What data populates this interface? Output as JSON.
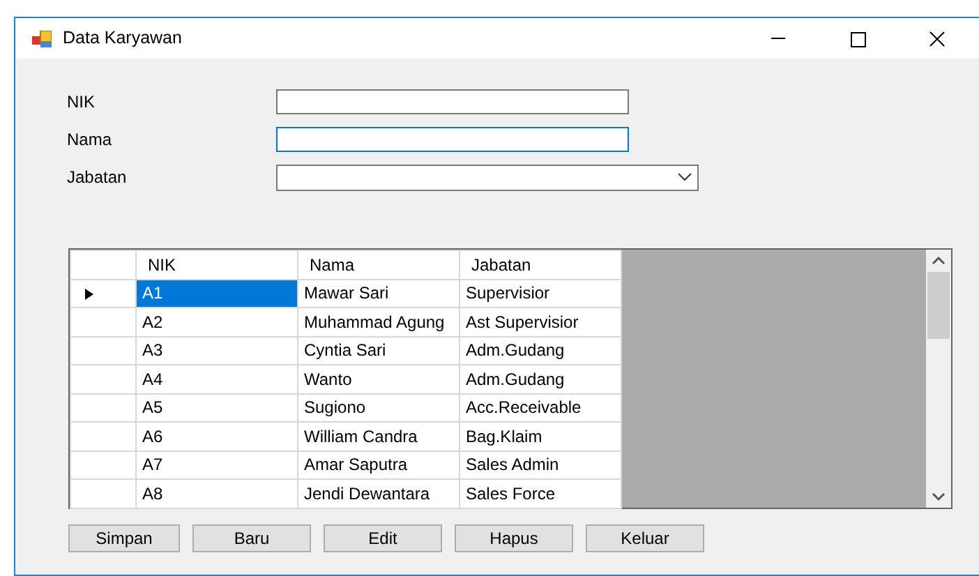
{
  "window": {
    "title": "Data Karyawan"
  },
  "form": [
    {
      "label": "NIK",
      "kind": "text",
      "focused": false
    },
    {
      "label": "Nama",
      "kind": "text",
      "focused": true
    },
    {
      "label": "Jabatan",
      "kind": "combo",
      "focused": false
    }
  ],
  "table": {
    "columns": [
      "NIK",
      "Nama",
      "Jabatan"
    ],
    "rows": [
      {
        "nik": "A1",
        "nama": "Mawar Sari",
        "jabatan": "Supervisior",
        "selected": true
      },
      {
        "nik": "A2",
        "nama": "Muhammad Agung",
        "jabatan": "Ast Supervisior",
        "selected": false
      },
      {
        "nik": "A3",
        "nama": "Cyntia Sari",
        "jabatan": "Adm.Gudang",
        "selected": false
      },
      {
        "nik": "A4",
        "nama": "Wanto",
        "jabatan": "Adm.Gudang",
        "selected": false
      },
      {
        "nik": "A5",
        "nama": "Sugiono",
        "jabatan": "Acc.Receivable",
        "selected": false
      },
      {
        "nik": "A6",
        "nama": "William Candra",
        "jabatan": "Bag.Klaim",
        "selected": false
      },
      {
        "nik": "A7",
        "nama": "Amar Saputra",
        "jabatan": "Sales Admin",
        "selected": false
      },
      {
        "nik": "A8",
        "nama": "Jendi Dewantara",
        "jabatan": "Sales Force",
        "selected": false
      }
    ]
  },
  "buttons": [
    "Simpan",
    "Baru",
    "Edit",
    "Hapus",
    "Keluar"
  ]
}
